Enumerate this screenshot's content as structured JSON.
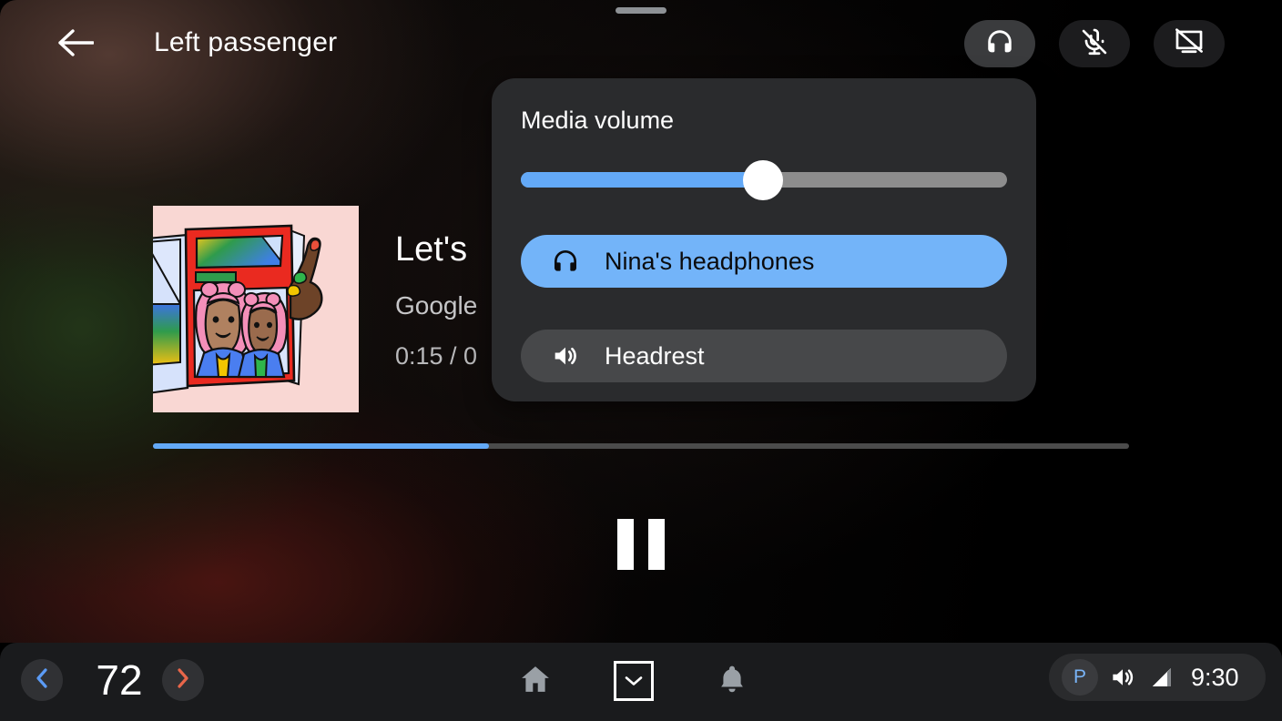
{
  "window": {
    "title": "Left passenger",
    "drag_handle": "drag-handle",
    "back_icon": "arrow-left-icon"
  },
  "topbar": {
    "buttons": [
      {
        "name": "headphones-toggle",
        "icon": "headphones-icon",
        "active": true
      },
      {
        "name": "mic-off-toggle",
        "icon": "mic-off-icon",
        "active": false
      },
      {
        "name": "screen-off-toggle",
        "icon": "screen-off-icon",
        "active": false
      }
    ]
  },
  "media": {
    "title": "Let's",
    "artist": "Google",
    "time": "0:15 / 0",
    "album_art_alt": "illustration-two-women-pink-hair-magazine",
    "progress_percent": 34,
    "transport_icon": "pause-icon",
    "progress_accent": "#63a9f7"
  },
  "volume_popup": {
    "title": "Media volume",
    "slider": {
      "value_percent": 50,
      "fill_color": "#63a9f7",
      "track_color": "#8d8d8d",
      "thumb_color": "#ffffff"
    },
    "devices": [
      {
        "label": "Nina's headphones",
        "icon": "headphones-icon",
        "selected": true,
        "background": "#73b4f9"
      },
      {
        "label": "Headrest",
        "icon": "speaker-volume-icon",
        "selected": false,
        "background": "#47484a"
      }
    ]
  },
  "system_bar": {
    "temperature": {
      "value": "72",
      "decrease_icon": "chevron-left-icon",
      "increase_icon": "chevron-right-icon",
      "decrease_color": "#5b9bf5",
      "increase_color": "#e8664a"
    },
    "nav": [
      {
        "name": "home",
        "icon": "home-icon"
      },
      {
        "name": "apps",
        "icon": "chevron-down-boxed-icon"
      },
      {
        "name": "notifications",
        "icon": "bell-icon"
      }
    ],
    "status": {
      "gear": "P",
      "gear_color": "#79b4f7",
      "volume_icon": "speaker-volume-icon",
      "signal_icon": "signal-bars-icon",
      "clock": "9:30"
    }
  }
}
